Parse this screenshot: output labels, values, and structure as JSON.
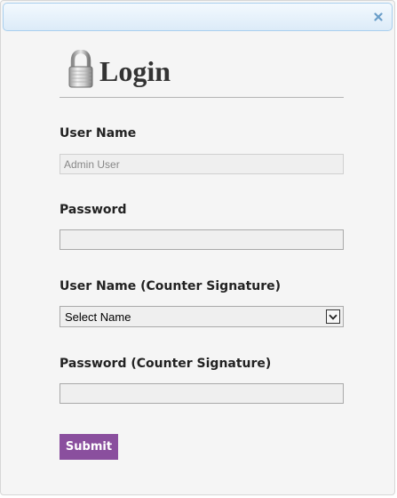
{
  "dialog": {
    "close_icon": "close-icon",
    "accent_color": "#8a4f9e"
  },
  "header": {
    "icon": "padlock-icon",
    "title": "Login"
  },
  "form": {
    "username_label": "User Name",
    "username_value": "Admin User",
    "password_label": "Password",
    "password_value": "",
    "counter_username_label": "User Name (Counter Signature)",
    "counter_username_selected": "Select Name",
    "counter_password_label": "Password (Counter Signature)",
    "counter_password_value": "",
    "submit_label": "Submit"
  }
}
